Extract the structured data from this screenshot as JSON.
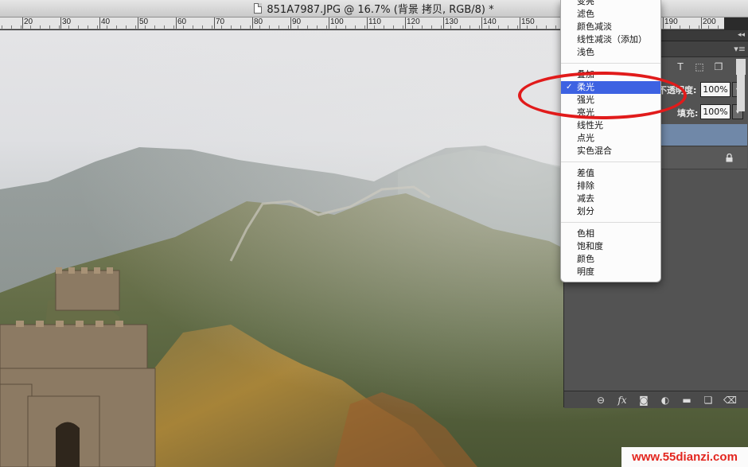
{
  "window": {
    "title": "851A7987.JPG @ 16.7% (背景 拷贝, RGB/8) *"
  },
  "ruler": {
    "labels": [
      "20",
      "30",
      "40",
      "50",
      "60",
      "70",
      "80",
      "90",
      "100",
      "110",
      "120",
      "130",
      "140",
      "150",
      "160",
      "190",
      "200"
    ]
  },
  "blend_menu": {
    "groups": [
      [
        "变亮",
        "滤色",
        "颜色减淡",
        "线性减淡（添加）",
        "浅色"
      ],
      [
        "叠加",
        "柔光",
        "强光",
        "亮光",
        "线性光",
        "点光",
        "实色混合"
      ],
      [
        "差值",
        "排除",
        "减去",
        "划分"
      ],
      [
        "色相",
        "饱和度",
        "颜色",
        "明度"
      ]
    ],
    "selected": "柔光",
    "check_glyph": "✓"
  },
  "layers_panel": {
    "opacity_label": "不透明度:",
    "opacity_value": "100%",
    "fill_label": "填充:",
    "fill_value": "100%"
  },
  "icons": [
    "document-icon",
    "text-layer-icon",
    "shape-layer-icon",
    "smart-object-icon",
    "lock-icon",
    "link-icon",
    "fx-icon",
    "mask-icon",
    "adjustment-icon",
    "folder-icon",
    "new-layer-icon",
    "trash-icon"
  ],
  "highlight_color": "#e11b1b",
  "menu_accent_color": "#3d62e2",
  "watermark": "www.55dianzi.com"
}
